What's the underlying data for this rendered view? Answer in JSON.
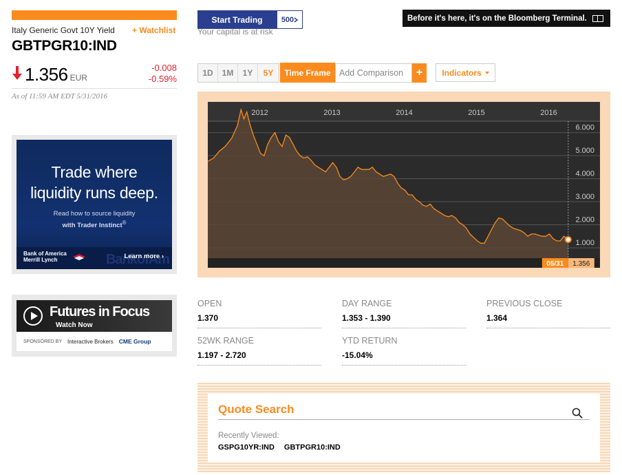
{
  "quote": {
    "name": "Italy Generic Govt 10Y Yield",
    "watchlist_label": "+ Watchlist",
    "ticker": "GBTPGR10:IND",
    "price": "1.356",
    "currency": "EUR",
    "change": "-0.008",
    "change_pct": "-0.59%",
    "as_of": "As of 11:59 AM EDT 5/31/2016",
    "direction_icon": "arrow-down-icon"
  },
  "header": {
    "start_trading": "Start Trading",
    "badge": "500",
    "capital_note": "Your capital is at risk",
    "terminal_ad": "Before it's here, it's on the Bloomberg Terminal.",
    "terminal_icon": "terminal-keyboard-icon"
  },
  "ads": {
    "ad1": {
      "headline_1": "Trade where",
      "headline_2": "liquidity runs deep.",
      "sub_1": "Read how to source liquidity",
      "sub_2": "with Trader Instinct",
      "logo_1": "Bank of America",
      "logo_2": "Merrill Lynch",
      "cta": "Learn more ›"
    },
    "ad2": {
      "title": "Futures in Focus",
      "watch": "Watch Now",
      "sponsored": "SPONSORED BY",
      "sponsor_1": "Interactive Brokers",
      "sponsor_2": "CME Group"
    }
  },
  "chart_controls": {
    "ranges": [
      "1D",
      "1M",
      "1Y",
      "5Y"
    ],
    "active_range": "5Y",
    "time_frame": "Time Frame",
    "add_comparison_placeholder": "Add Comparison",
    "add_icon": "+",
    "indicators": "Indicators"
  },
  "chart_data": {
    "type": "area",
    "x_ticks": [
      "2012",
      "2013",
      "2014",
      "2015",
      "2016"
    ],
    "y_ticks": [
      "6.000",
      "5.000",
      "4.000",
      "3.000",
      "2.000",
      "1.000"
    ],
    "ylim": [
      0.55,
      6.5
    ],
    "grid": true,
    "marker_date_label": "05/31",
    "marker_value_label": "1.356",
    "colors": {
      "line": "#fb8b1e",
      "background": "#2b2b2b",
      "fill": "#5a4635",
      "grid": "#555555"
    },
    "series": [
      {
        "values": [
          [
            2011.42,
            4.75
          ],
          [
            2011.5,
            4.9
          ],
          [
            2011.58,
            5.2
          ],
          [
            2011.66,
            5.4
          ],
          [
            2011.75,
            5.75
          ],
          [
            2011.83,
            6.3
          ],
          [
            2011.88,
            7.0
          ],
          [
            2011.92,
            6.6
          ],
          [
            2011.96,
            6.9
          ],
          [
            2012.0,
            6.4
          ],
          [
            2012.05,
            5.9
          ],
          [
            2012.1,
            5.5
          ],
          [
            2012.15,
            5.1
          ],
          [
            2012.2,
            5.0
          ],
          [
            2012.25,
            5.5
          ],
          [
            2012.3,
            5.8
          ],
          [
            2012.35,
            6.0
          ],
          [
            2012.4,
            5.6
          ],
          [
            2012.45,
            5.4
          ],
          [
            2012.5,
            5.9
          ],
          [
            2012.55,
            5.8
          ],
          [
            2012.6,
            5.5
          ],
          [
            2012.65,
            5.2
          ],
          [
            2012.7,
            5.0
          ],
          [
            2012.75,
            4.9
          ],
          [
            2012.8,
            4.95
          ],
          [
            2012.85,
            4.8
          ],
          [
            2012.9,
            4.6
          ],
          [
            2012.95,
            4.5
          ],
          [
            2013.0,
            4.4
          ],
          [
            2013.05,
            4.3
          ],
          [
            2013.1,
            4.5
          ],
          [
            2013.15,
            4.7
          ],
          [
            2013.2,
            4.5
          ],
          [
            2013.25,
            4.1
          ],
          [
            2013.3,
            3.95
          ],
          [
            2013.35,
            4.0
          ],
          [
            2013.4,
            4.1
          ],
          [
            2013.45,
            4.3
          ],
          [
            2013.5,
            4.5
          ],
          [
            2013.55,
            4.4
          ],
          [
            2013.6,
            4.4
          ],
          [
            2013.65,
            4.4
          ],
          [
            2013.7,
            4.5
          ],
          [
            2013.75,
            4.3
          ],
          [
            2013.8,
            4.2
          ],
          [
            2013.85,
            4.1
          ],
          [
            2013.9,
            4.15
          ],
          [
            2013.95,
            4.2
          ],
          [
            2014.0,
            4.1
          ],
          [
            2014.05,
            3.8
          ],
          [
            2014.1,
            3.6
          ],
          [
            2014.15,
            3.5
          ],
          [
            2014.2,
            3.3
          ],
          [
            2014.25,
            3.3
          ],
          [
            2014.3,
            3.1
          ],
          [
            2014.35,
            3.0
          ],
          [
            2014.4,
            2.85
          ],
          [
            2014.45,
            2.8
          ],
          [
            2014.5,
            2.9
          ],
          [
            2014.55,
            2.7
          ],
          [
            2014.6,
            2.6
          ],
          [
            2014.65,
            2.5
          ],
          [
            2014.7,
            2.4
          ],
          [
            2014.75,
            2.35
          ],
          [
            2014.8,
            2.4
          ],
          [
            2014.85,
            2.3
          ],
          [
            2014.9,
            2.1
          ],
          [
            2014.95,
            2.0
          ],
          [
            2015.0,
            1.85
          ],
          [
            2015.05,
            1.6
          ],
          [
            2015.1,
            1.45
          ],
          [
            2015.15,
            1.3
          ],
          [
            2015.2,
            1.2
          ],
          [
            2015.25,
            1.2
          ],
          [
            2015.3,
            1.5
          ],
          [
            2015.35,
            1.8
          ],
          [
            2015.4,
            2.1
          ],
          [
            2015.45,
            2.3
          ],
          [
            2015.5,
            2.25
          ],
          [
            2015.55,
            2.1
          ],
          [
            2015.6,
            1.95
          ],
          [
            2015.65,
            1.85
          ],
          [
            2015.7,
            1.8
          ],
          [
            2015.75,
            1.75
          ],
          [
            2015.8,
            1.65
          ],
          [
            2015.85,
            1.5
          ],
          [
            2015.9,
            1.6
          ],
          [
            2015.95,
            1.6
          ],
          [
            2016.0,
            1.55
          ],
          [
            2016.05,
            1.5
          ],
          [
            2016.1,
            1.5
          ],
          [
            2016.15,
            1.6
          ],
          [
            2016.2,
            1.4
          ],
          [
            2016.25,
            1.3
          ],
          [
            2016.3,
            1.3
          ],
          [
            2016.35,
            1.5
          ],
          [
            2016.41,
            1.356
          ]
        ]
      }
    ]
  },
  "stats": [
    {
      "label": "OPEN",
      "value": "1.370"
    },
    {
      "label": "DAY RANGE",
      "value": "1.353 - 1.390"
    },
    {
      "label": "PREVIOUS CLOSE",
      "value": "1.364"
    },
    {
      "label": "52WK RANGE",
      "value": "1.197 - 2.720"
    },
    {
      "label": "YTD RETURN",
      "value": "-15.04%"
    }
  ],
  "quote_search": {
    "title": "Quote Search",
    "search_icon": "search-icon",
    "recently_viewed_label": "Recently Viewed:",
    "recent": [
      "GSPG10YR:IND",
      "GBTPGR10:IND"
    ]
  }
}
